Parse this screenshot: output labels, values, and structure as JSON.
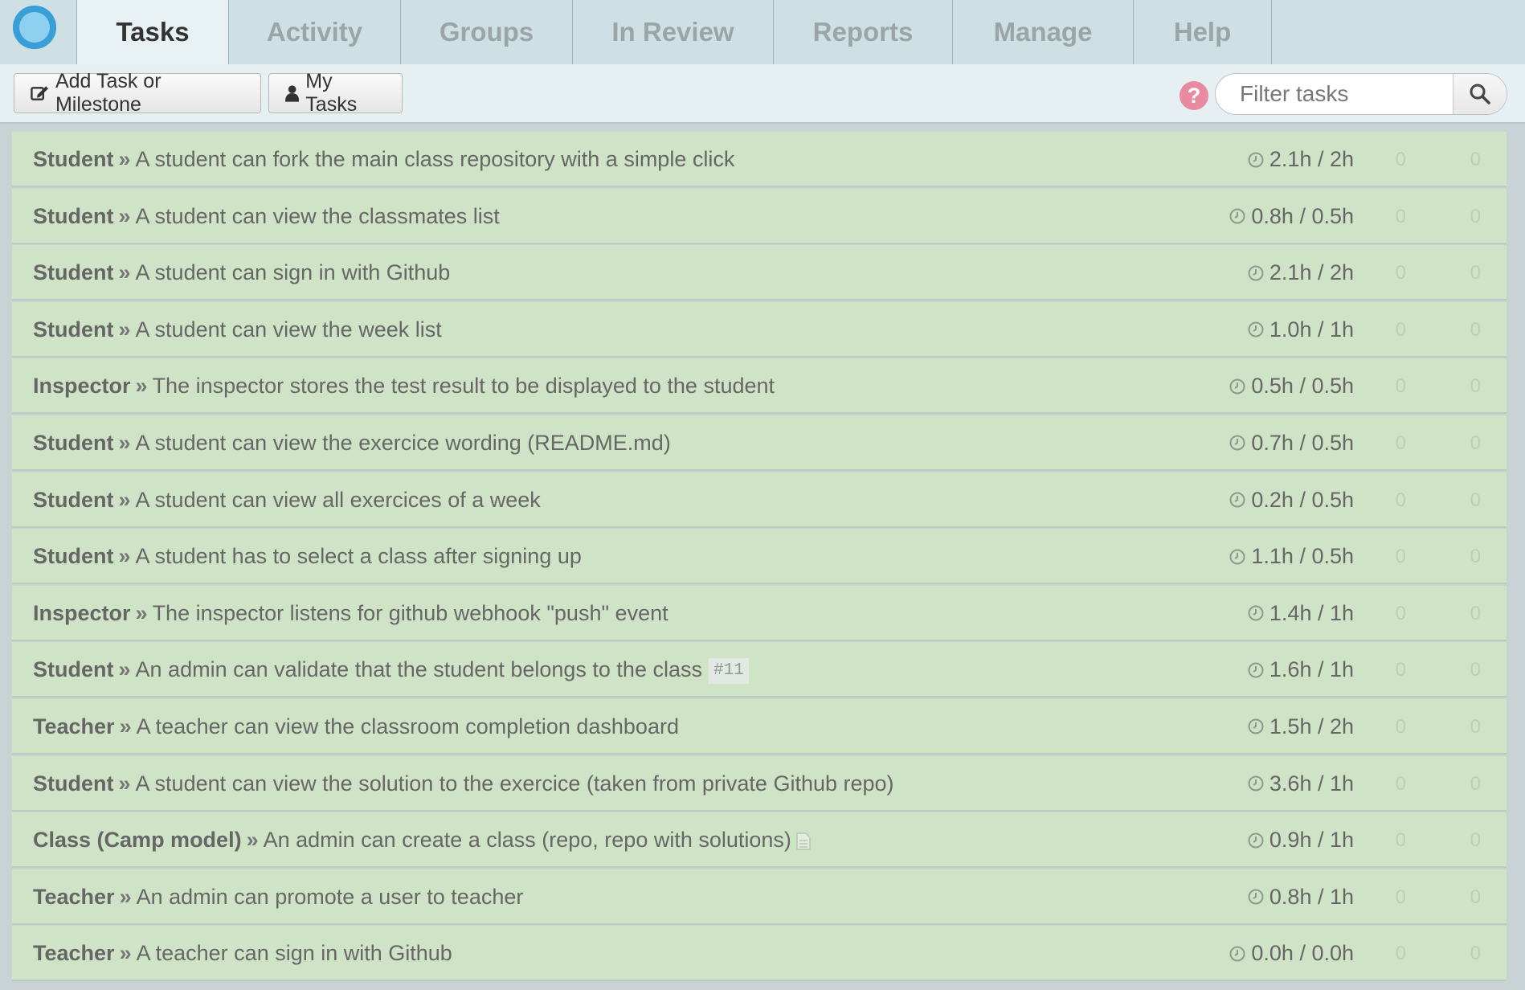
{
  "nav": {
    "tabs": [
      "Tasks",
      "Activity",
      "Groups",
      "In Review",
      "Reports",
      "Manage",
      "Help"
    ]
  },
  "toolbar": {
    "add_label": "Add Task or Milestone",
    "my_tasks_label": "My Tasks",
    "help_label": "?",
    "search_placeholder": "Filter tasks"
  },
  "tasks": [
    {
      "group": "Student",
      "title": "A student can fork the main class repository with a simple click",
      "time": "2.1h / 2h",
      "c1": "0",
      "c2": "0"
    },
    {
      "group": "Student",
      "title": "A student can view the classmates list",
      "time": "0.8h / 0.5h",
      "c1": "0",
      "c2": "0"
    },
    {
      "group": "Student",
      "title": "A student can sign in with Github",
      "time": "2.1h / 2h",
      "c1": "0",
      "c2": "0"
    },
    {
      "group": "Student",
      "title": "A student can view the week list",
      "time": "1.0h / 1h",
      "c1": "0",
      "c2": "0"
    },
    {
      "group": "Inspector",
      "title": "The inspector stores the test result to be displayed to the student",
      "time": "0.5h / 0.5h",
      "c1": "0",
      "c2": "0"
    },
    {
      "group": "Student",
      "title": "A student can view the exercice wording (README.md)",
      "time": "0.7h / 0.5h",
      "c1": "0",
      "c2": "0"
    },
    {
      "group": "Student",
      "title": "A student can view all exercices of a week",
      "time": "0.2h / 0.5h",
      "c1": "0",
      "c2": "0"
    },
    {
      "group": "Student",
      "title": "A student has to select a class after signing up",
      "time": "1.1h / 0.5h",
      "c1": "0",
      "c2": "0"
    },
    {
      "group": "Inspector",
      "title": "The inspector listens for github webhook \"push\" event",
      "time": "1.4h / 1h",
      "c1": "0",
      "c2": "0"
    },
    {
      "group": "Student",
      "title": "An admin can validate that the student belongs to the class",
      "tag": "#11",
      "time": "1.6h / 1h",
      "c1": "0",
      "c2": "0"
    },
    {
      "group": "Teacher",
      "title": "A teacher can view the classroom completion dashboard",
      "time": "1.5h / 2h",
      "c1": "0",
      "c2": "0"
    },
    {
      "group": "Student",
      "title": "A student can view the solution to the exercice (taken from private Github repo)",
      "time": "3.6h / 1h",
      "c1": "0",
      "c2": "0"
    },
    {
      "group": "Class (Camp model)",
      "title": "An admin can create a class (repo, repo with solutions)",
      "doc_icon": "document-icon",
      "time": "0.9h / 1h",
      "c1": "0",
      "c2": "0"
    },
    {
      "group": "Teacher",
      "title": "An admin can promote a user to teacher",
      "time": "0.8h / 1h",
      "c1": "0",
      "c2": "0"
    },
    {
      "group": "Teacher",
      "title": "A teacher can sign in with Github",
      "time": "0.0h / 0.0h",
      "c1": "0",
      "c2": "0"
    }
  ],
  "separator": "»",
  "colors": {
    "row_bg": "#cfe3c6",
    "nav_bg": "#cfe0e4",
    "help_pink": "#e88aa0",
    "logo_blue": "#3a9fd6"
  }
}
